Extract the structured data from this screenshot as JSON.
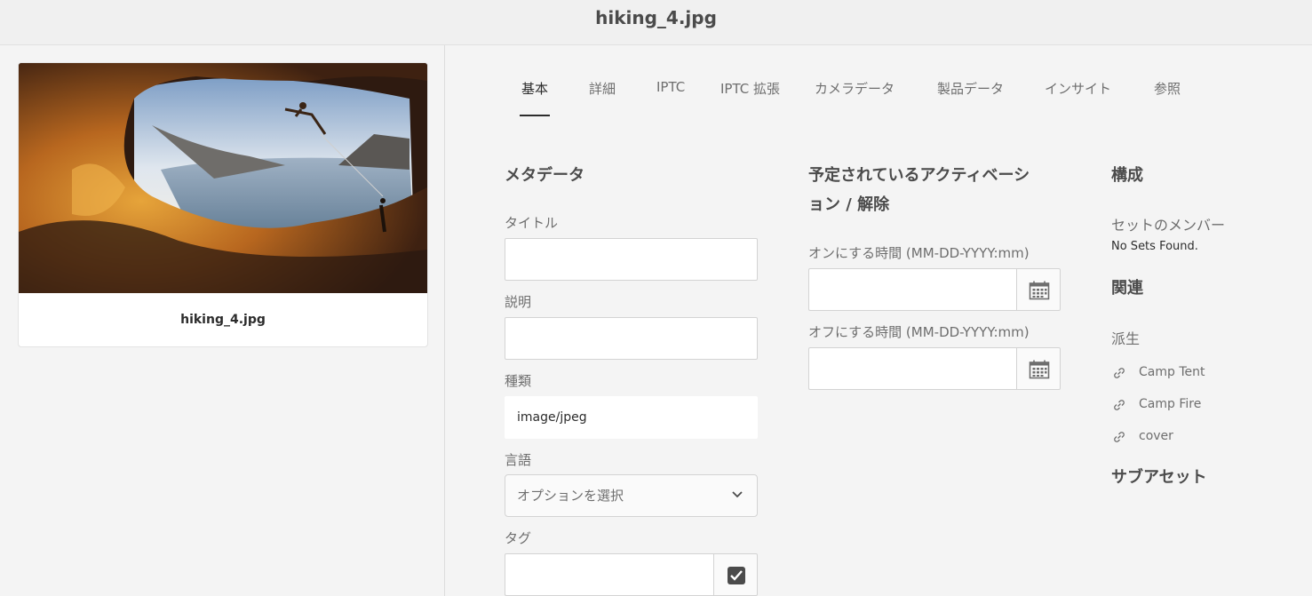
{
  "header": {
    "title": "hiking_4.jpg"
  },
  "asset_card": {
    "caption": "hiking_4.jpg"
  },
  "tabs": [
    {
      "label": "基本",
      "active": true
    },
    {
      "label": "詳細"
    },
    {
      "label": "IPTC"
    },
    {
      "label": "IPTC 拡張"
    },
    {
      "label": "カメラデータ"
    },
    {
      "label": "製品データ"
    },
    {
      "label": "インサイト"
    },
    {
      "label": "参照"
    }
  ],
  "metadata": {
    "heading": "メタデータ",
    "title_label": "タイトル",
    "title_value": "",
    "description_label": "説明",
    "description_value": "",
    "type_label": "種類",
    "type_value": "image/jpeg",
    "language_label": "言語",
    "language_placeholder": "オプションを選択",
    "tags_label": "タグ",
    "tags_value": ""
  },
  "activation": {
    "heading_line1": "予定されているアクティベーシ",
    "heading_line2": "ョン / 解除",
    "on_label": "オンにする時間 (MM-DD-YYYY:mm)",
    "on_value": "",
    "off_label": "オフにする時間 (MM-DD-YYYY:mm)",
    "off_value": ""
  },
  "composition": {
    "heading": "構成",
    "sets_label": "セットのメンバー",
    "sets_value": "No Sets Found.",
    "related_heading": "関連",
    "derived_label": "派生",
    "links": [
      "Camp Tent",
      "Camp Fire",
      "cover"
    ],
    "subassets_heading": "サブアセット"
  },
  "icons": {
    "calendar": "calendar-icon",
    "chevron": "chevron-down-icon",
    "checkbox": "checkbox-checked-icon",
    "link": "link-icon"
  }
}
